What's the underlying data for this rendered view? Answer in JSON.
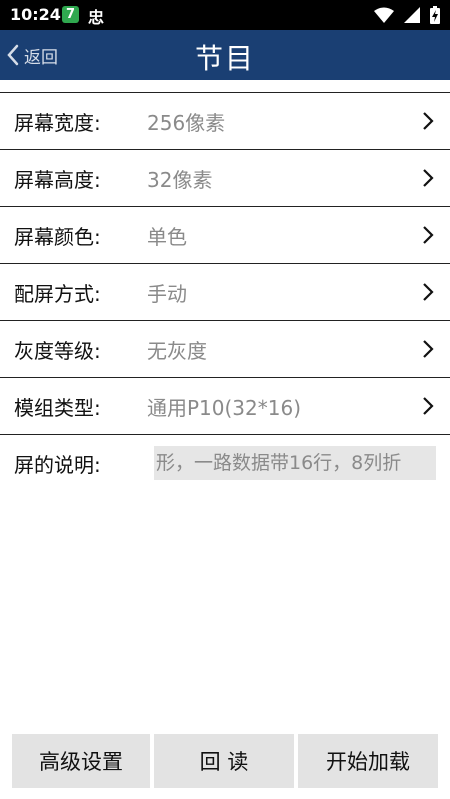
{
  "status_bar": {
    "time": "10:24",
    "badge": "7",
    "notif_char": "忠"
  },
  "nav": {
    "back_label": "返回",
    "title": "节目"
  },
  "rows": [
    {
      "label": "屏幕宽度:",
      "value": "256像素"
    },
    {
      "label": "屏幕高度:",
      "value": "32像素"
    },
    {
      "label": "屏幕颜色:",
      "value": "单色"
    },
    {
      "label": "配屏方式:",
      "value": "手动"
    },
    {
      "label": "灰度等级:",
      "value": "无灰度"
    },
    {
      "label": "模组类型:",
      "value": "通用P10(32*16)"
    }
  ],
  "description_row": {
    "label": "屏的说明:",
    "value": "形，一路数据带16行，8列折"
  },
  "buttons": {
    "advanced": "高级设置",
    "readback": "回 读",
    "load": "开始加载"
  },
  "colors": {
    "nav": "#1a3f73",
    "status": "#000000",
    "button_bg": "#e3e3e3"
  }
}
